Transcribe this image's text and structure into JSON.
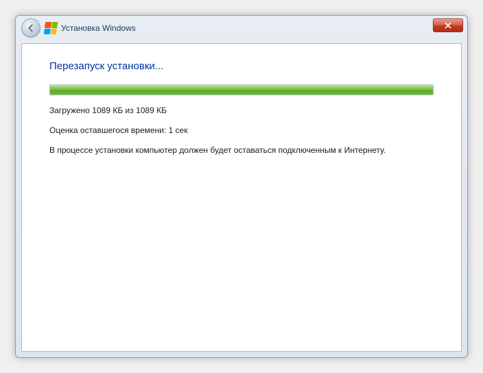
{
  "titlebar": {
    "title": "Установка Windows"
  },
  "content": {
    "heading": "Перезапуск установки...",
    "downloaded": "Загружено 1089 КБ из 1089 КБ",
    "timeRemaining": "Оценка оставшегося времени: 1 сек",
    "note": "В процессе установки компьютер должен будет оставаться подключенным к Интернету."
  }
}
